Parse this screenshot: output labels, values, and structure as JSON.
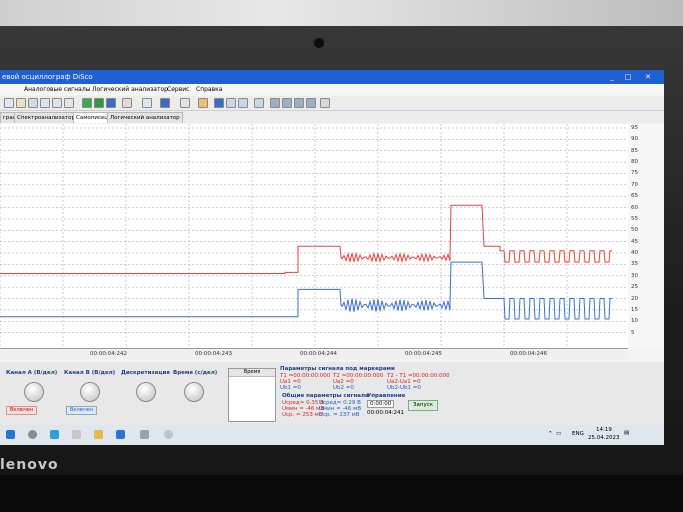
{
  "window": {
    "title": "евой осциллограф DiSco",
    "controls": [
      "_",
      "□",
      "✕"
    ]
  },
  "menu": [
    "Аналоговые сигналы",
    "Логический анализатор",
    "Сервис",
    "Справка"
  ],
  "tabs": [
    "граф",
    "Спектроанализатор",
    "Самописец",
    "Логический анализатор"
  ],
  "active_tab": "Самописец",
  "y_ticks": [
    "95",
    "90",
    "85",
    "80",
    "75",
    "70",
    "65",
    "60",
    "55",
    "50",
    "45",
    "40",
    "35",
    "30",
    "25",
    "20",
    "15",
    "10",
    "5"
  ],
  "x_ticks": [
    "00:00:04:242",
    "00:00:04:243",
    "00:00:04:244",
    "00:00:04:245",
    "00:00:04:246"
  ],
  "colors": {
    "channel_a": "#e8423a",
    "channel_b": "#3b6fd0",
    "grid": "#9b9b9b"
  },
  "chart_data": {
    "type": "line",
    "xlabel": "",
    "ylabel": "",
    "ylim": [
      0,
      95
    ],
    "grid": true,
    "series": [
      {
        "name": "Канал A",
        "x": [
          0,
          285,
          298,
          340,
          342,
          450,
          452,
          482,
          486,
          500
        ],
        "y": [
          31,
          31.5,
          43,
          43,
          38,
          38,
          61,
          61,
          43,
          36
        ]
      },
      {
        "name": "Канал B",
        "x": [
          0,
          292,
          298,
          340,
          342,
          450,
          452,
          482,
          486,
          500
        ],
        "y": [
          12,
          12,
          24,
          24,
          17,
          17,
          36,
          36,
          20,
          11
        ]
      }
    ]
  },
  "panel": {
    "channel_a": {
      "title": "Канал А (В/дел)",
      "button": "Включен"
    },
    "channel_b": {
      "title": "Канал В (В/дел)",
      "button": "Включен"
    },
    "sampling": {
      "title": "Дискретизация"
    },
    "time": {
      "title": "Время (с/дел)"
    },
    "list": {
      "header": "Время"
    },
    "markers": {
      "title": "Параметры сигнала под маркерами",
      "t1": "T1 =00:00:00:000",
      "t2": "T2 =00:00:00:000",
      "dt": "T2 - T1 =00:00:00:000",
      "ua1": "Ua1 =0",
      "ua2": "Ua2 =0",
      "ub1": "Ub1 =0",
      "ub2": "Ub2 =0",
      "dua": "Ua2-Ua1 =0",
      "dub": "Ub2-Ub1 =0"
    },
    "common": {
      "title": "Общие параметры сигнала",
      "a1": "Uсред= 0.35 В",
      "a2": "Uмин = -46 мВ",
      "a3": "Uср. = 253 мВ",
      "b1": "Uсред= 0.29 В",
      "b2": "Uмин = -46 мВ",
      "b3": "Uср. = 237 мВ"
    },
    "control": {
      "title": "Управление",
      "time_value": "0:00:00",
      "time_readout": "00:00:04:241",
      "start": "Запуск"
    }
  },
  "taskbar": {
    "lang": "ENG",
    "time": "14:19",
    "date": "25.04.2023"
  },
  "logo": "lenovo"
}
